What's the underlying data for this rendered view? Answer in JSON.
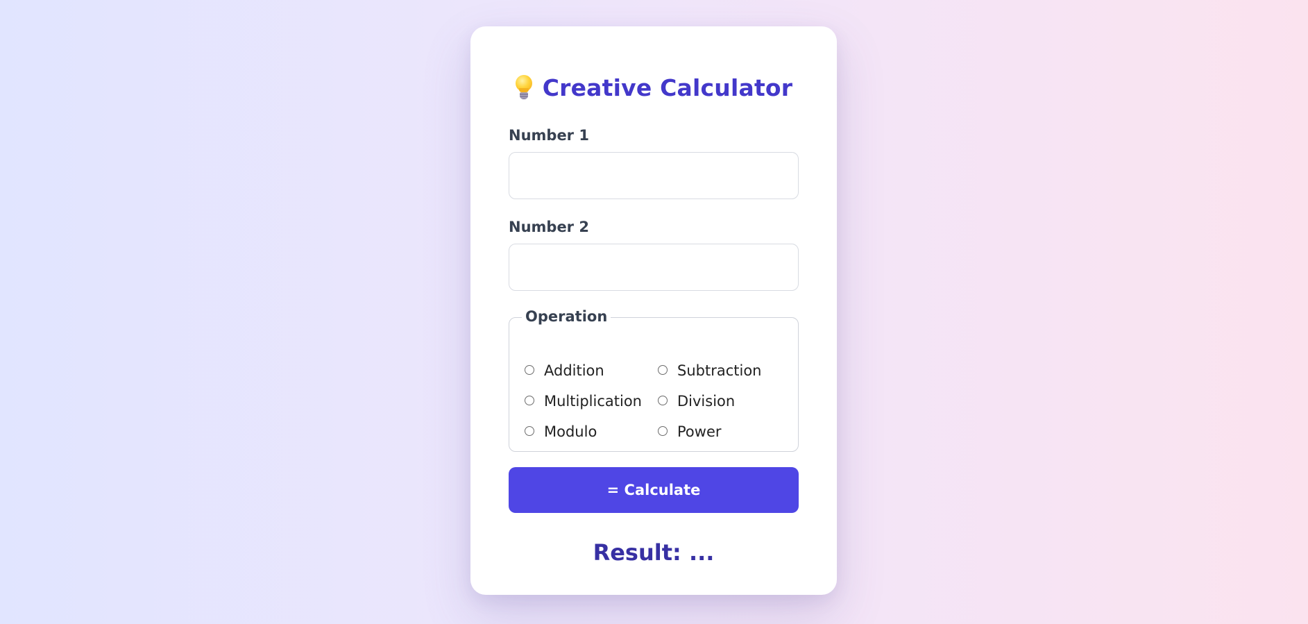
{
  "app": {
    "title": "Creative Calculator",
    "title_icon": "lightbulb-icon",
    "accent_color": "#4f46e5",
    "title_color": "#4338ca"
  },
  "form": {
    "number1": {
      "label": "Number 1",
      "value": "",
      "placeholder": ""
    },
    "number2": {
      "label": "Number 2",
      "value": "",
      "placeholder": ""
    },
    "operation": {
      "legend": "Operation",
      "options": [
        {
          "label": "Addition",
          "checked": false
        },
        {
          "label": "Subtraction",
          "checked": false
        },
        {
          "label": "Multiplication",
          "checked": false
        },
        {
          "label": "Division",
          "checked": false
        },
        {
          "label": "Modulo",
          "checked": false
        },
        {
          "label": "Power",
          "checked": false
        }
      ]
    },
    "calculate_label": "= Calculate"
  },
  "result": {
    "text": "Result: ..."
  }
}
